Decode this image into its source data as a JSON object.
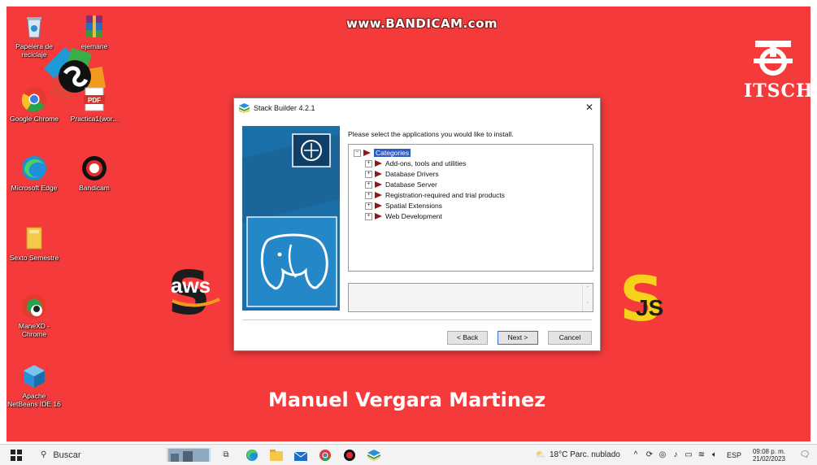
{
  "watermark": "www.BANDICAM.com",
  "desktop": {
    "icons": [
      {
        "name": "recycle-bin",
        "label": "Papelera de reciclaje"
      },
      {
        "name": "winrar-archive",
        "label": "ejemane"
      },
      {
        "name": "google-chrome",
        "label": "Google Chrome"
      },
      {
        "name": "pdf-document",
        "label": "Practica1(wor..."
      },
      {
        "name": "microsoft-edge",
        "label": "Microsoft Edge"
      },
      {
        "name": "bandicam",
        "label": "Bandicam"
      },
      {
        "name": "folder",
        "label": "Sexto Semestre"
      },
      {
        "name": "chrome-profile",
        "label": "ManeXD - Chrome"
      },
      {
        "name": "netbeans",
        "label": "Apache NetBeans IDE 16"
      }
    ],
    "logo_text": "ITSCH",
    "aws_text": "aws",
    "js_text": "JS",
    "author": "Manuel Vergara Martinez"
  },
  "dialog": {
    "title": "Stack Builder 4.2.1",
    "prompt": "Please select the applications you would like to install.",
    "tree": {
      "root": "Categories",
      "items": [
        "Add-ons, tools and utilities",
        "Database Drivers",
        "Database Server",
        "Registration-required and trial products",
        "Spatial Extensions",
        "Web Development"
      ]
    },
    "buttons": {
      "back": "< Back",
      "next": "Next >",
      "cancel": "Cancel"
    }
  },
  "taskbar": {
    "search_label": "Buscar",
    "weather": "18°C  Parc. nublado",
    "language": "ESP",
    "time": "09:08 p. m.",
    "date": "21/02/2023"
  }
}
